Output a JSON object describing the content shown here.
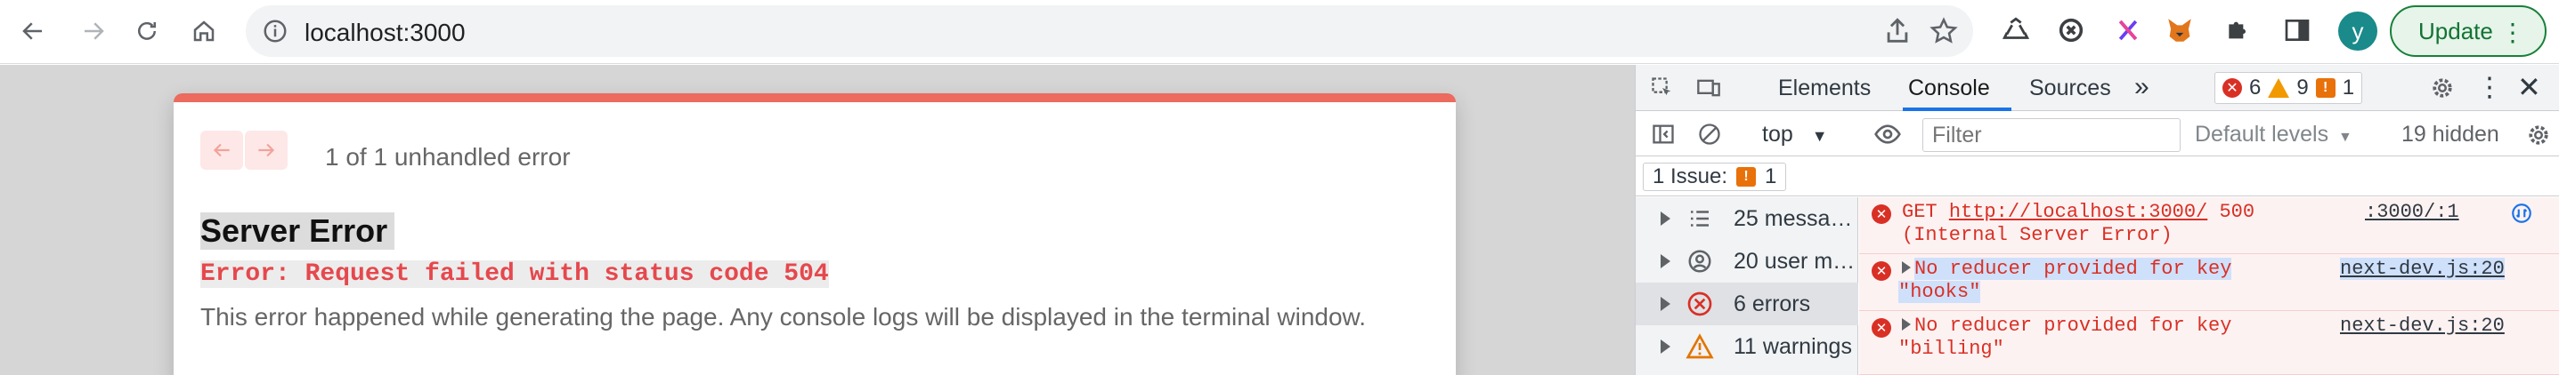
{
  "browser": {
    "url": "localhost:3000",
    "profile_initial": "y",
    "update_label": "Update",
    "icons": [
      "back-icon",
      "forward-icon",
      "reload-icon",
      "home-icon",
      "info-icon",
      "share-icon",
      "star-icon",
      "recycle-extension-icon",
      "sync-extension-icon",
      "x-extension-icon",
      "metamask-fox-icon",
      "puzzle-extensions-icon",
      "side-panel-icon"
    ]
  },
  "error_overlay": {
    "pagination": "1 of 1 unhandled error",
    "title": "Server Error",
    "message": "Error: Request failed with status code 504",
    "description": "This error happened while generating the page. Any console logs will be displayed in the terminal window.",
    "accent_color": "#ec6a5e"
  },
  "devtools": {
    "tabs": [
      "Elements",
      "Console",
      "Sources"
    ],
    "active_tab": "Console",
    "badges": {
      "errors": "6",
      "warnings": "9",
      "issues": "1"
    },
    "context": "top",
    "filter_placeholder": "Filter",
    "levels": "Default levels",
    "hidden": "19 hidden",
    "issues_label": "1 Issue:",
    "issues_count": "1",
    "sidebar": [
      {
        "label": "25 messa…",
        "icon": "list-icon"
      },
      {
        "label": "20 user m…",
        "icon": "user-icon"
      },
      {
        "label": "6 errors",
        "icon": "error-circle-icon"
      },
      {
        "label": "11 warnings",
        "icon": "warning-triangle-icon"
      }
    ],
    "logs": [
      {
        "line1_prefix": "GET ",
        "line1_url": "http://localhost:3000/",
        "line1_suffix": " 500",
        "line2": "(Internal Server Error)",
        "source": ":3000/:1"
      },
      {
        "line1": "No reducer provided for key",
        "line2": "\"hooks\"",
        "source": "next-dev.js:20"
      },
      {
        "line1": "No reducer provided for key",
        "line2": "\"billing\"",
        "source": "next-dev.js:20"
      }
    ]
  }
}
